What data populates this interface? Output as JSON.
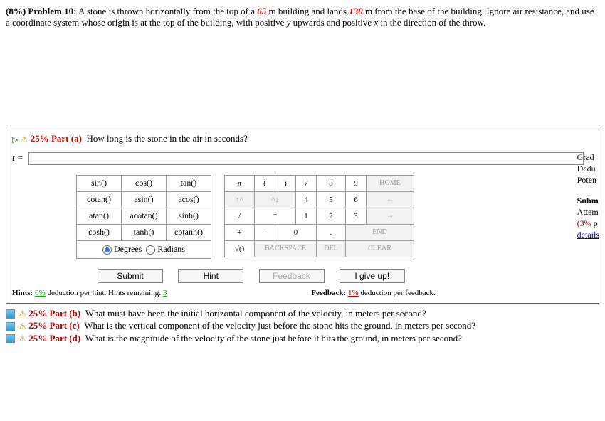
{
  "problem": {
    "percent": "(8%)",
    "label": "Problem 10:",
    "text1": "A stone is thrown horizontally from the top of a ",
    "h": "65",
    "text2": " m building and lands ",
    "d": "130",
    "text3": " m from the base of the building. Ignore air resistance, and use a coordinate system whose origin is at the top of the building, with positive ",
    "yv": "y",
    "text4": " upwards and positive ",
    "xv": "x",
    "text5": " in the direction of the throw."
  },
  "partA": {
    "pct": "25%",
    "label": "Part (a)",
    "q": "How long is the stone in the air in seconds?",
    "lhs": "t ="
  },
  "side": {
    "grad": "Grad",
    "dedu": "Dedu",
    "poten": "Poten",
    "subm": "Subm",
    "attem": "Attem",
    "pct": "(3%",
    "per": "p",
    "det": "details"
  },
  "fn": [
    [
      "sin()",
      "cos()",
      "tan()"
    ],
    [
      "cotan()",
      "asin()",
      "acos()"
    ],
    [
      "atan()",
      "acotan()",
      "sinh()"
    ],
    [
      "cosh()",
      "tanh()",
      "cotanh()"
    ]
  ],
  "deg": {
    "degrees": "Degrees",
    "radians": "Radians"
  },
  "num": {
    "pi": "π",
    "lp": "(",
    "rp": ")",
    "n7": "7",
    "n8": "8",
    "n9": "9",
    "home": "HOME",
    "up": "↑^",
    "dn": "^↓",
    "n4": "4",
    "n5": "5",
    "n6": "6",
    "left": "←",
    "sl": "/",
    "st": "*",
    "n1": "1",
    "n2": "2",
    "n3": "3",
    "right": "→",
    "pl": "+",
    "mi": "-",
    "n0": "0",
    "dot": ".",
    "end": "END",
    "rt": "√()",
    "bs": "BACKSPACE",
    "del": "DEL",
    "clr": "CLEAR"
  },
  "btns": {
    "submit": "Submit",
    "hint": "Hint",
    "feedback": "Feedback",
    "giveup": "I give up!"
  },
  "hints": {
    "h1": "Hints: ",
    "h_pct": "0%",
    "h2": " deduction per hint. Hints remaining: ",
    "h_rem": "3",
    "f1": "Feedback: ",
    "f_pct": "1%",
    "f2": " deduction per feedback."
  },
  "parts": {
    "b": {
      "pct": "25%",
      "label": "Part (b)",
      "q": "What must have been the initial horizontal component of the velocity, in meters per second?"
    },
    "c": {
      "pct": "25%",
      "label": "Part (c)",
      "q": "What is the vertical component of the velocity just before the stone hits the ground, in meters per second?"
    },
    "d": {
      "pct": "25%",
      "label": "Part (d)",
      "q": "What is the magnitude of the velocity of the stone just before it hits the ground, in meters per second?"
    }
  }
}
